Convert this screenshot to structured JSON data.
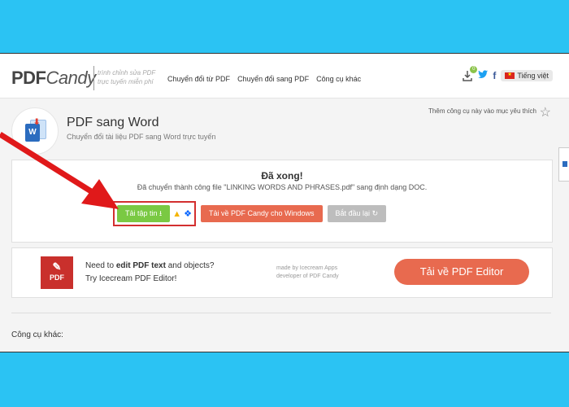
{
  "header": {
    "logo_pdf": "PDF",
    "logo_candy": "Candy",
    "tagline": "trình chỉnh sửa PDF trực tuyến miễn phí",
    "nav": [
      "Chuyển đổi từ PDF",
      "Chuyển đổi sang PDF",
      "Công cụ khác"
    ],
    "download_badge": "0",
    "facebook": "f",
    "language": "Tiếng việt"
  },
  "tool": {
    "title": "PDF sang Word",
    "subtitle": "Chuyển đổi tài liệu PDF sang Word trực tuyến",
    "favorite_text": "Thêm công cụ này vào mục yêu thích",
    "doc_letter": "W"
  },
  "result": {
    "heading": "Đã xong!",
    "message": "Đã chuyển thành công file \"LINKING WORDS AND PHRASES.pdf\" sang định dạng DOC.",
    "download_label": "Tải tập tin",
    "windows_label": "Tải về PDF Candy cho Windows",
    "restart_label": "Bắt đầu lại"
  },
  "promo": {
    "icon_label": "PDF",
    "line1_a": "Need to ",
    "line1_b": "edit PDF text",
    "line1_c": " and objects?",
    "line2": "Try Icecream PDF Editor!",
    "made_by_1": "made by Icecream Apps",
    "made_by_2": "developer of PDF Candy",
    "button": "Tải về PDF Editor"
  },
  "footer": {
    "other_tools": "Công cụ khác:"
  },
  "colors": {
    "frame": "#2bc3f3",
    "green": "#7ac943",
    "orange_red": "#e86a4f",
    "highlight": "#d32f2f"
  }
}
